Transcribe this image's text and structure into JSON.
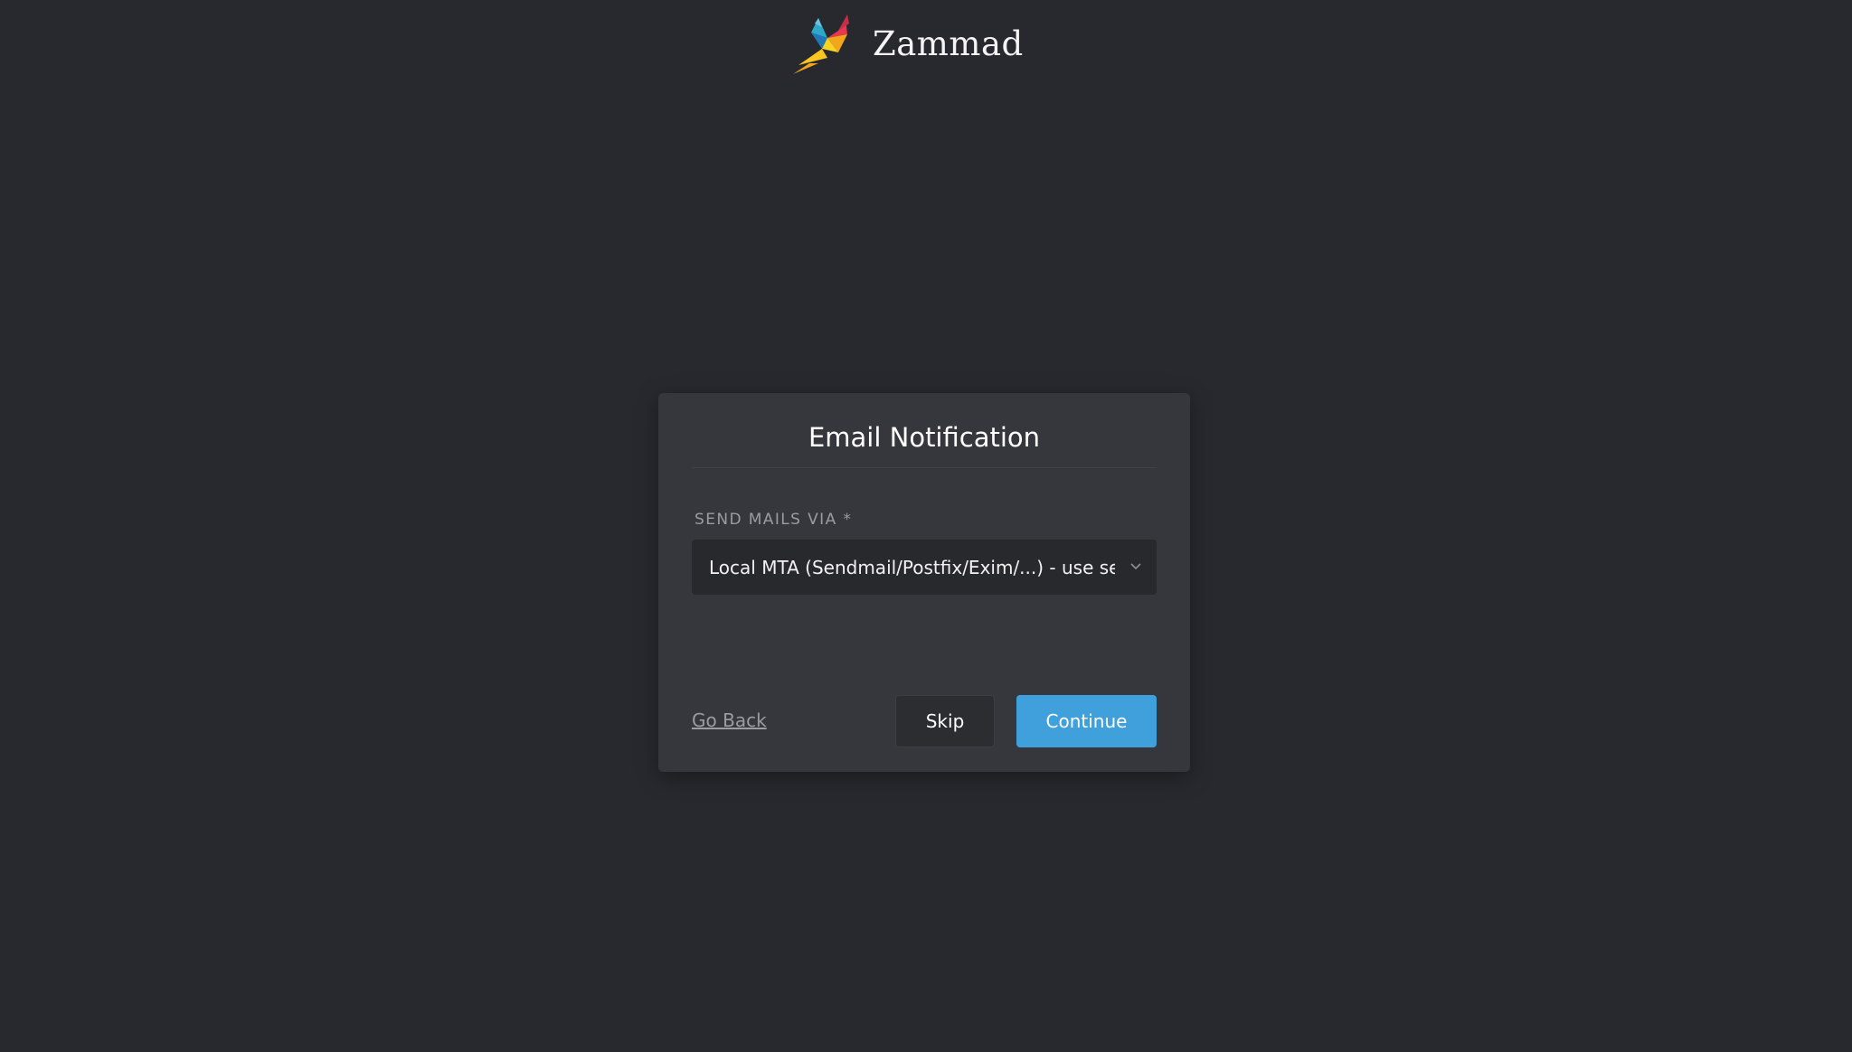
{
  "brand": {
    "name": "Zammad",
    "logo_icon": "zammad-bird-logo"
  },
  "modal": {
    "title": "Email Notification",
    "field": {
      "label": "SEND MAILS VIA *",
      "selected_value": "Local MTA (Sendmail/Postfix/Exim/...) - use server setting",
      "icon": "chevron-down-icon"
    },
    "actions": {
      "back_label": "Go Back",
      "skip_label": "Skip",
      "continue_label": "Continue"
    }
  },
  "colors": {
    "background": "#27292e",
    "modal": "#35373c",
    "accent": "#3fa0dc"
  }
}
